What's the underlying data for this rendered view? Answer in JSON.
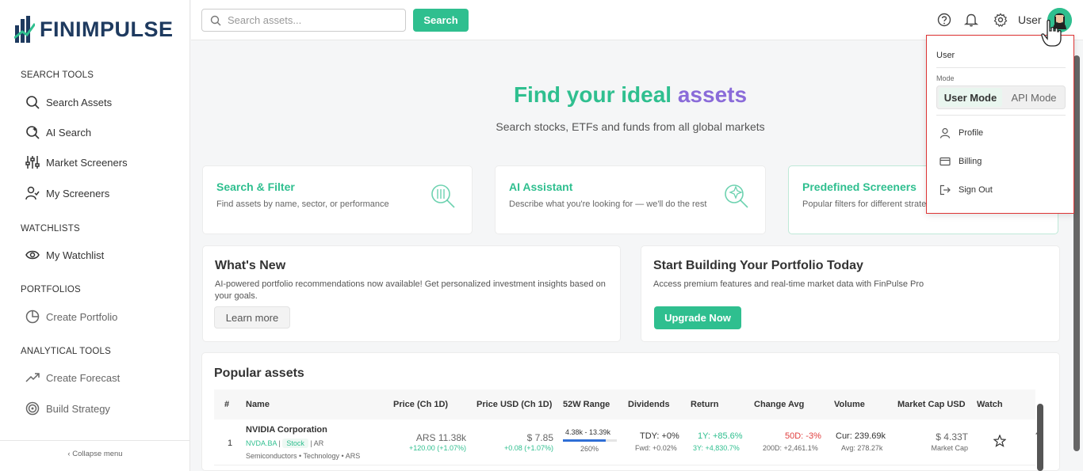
{
  "brand": {
    "name": "FINIMPULSE"
  },
  "sidebar": {
    "sections": [
      {
        "title": "SEARCH TOOLS",
        "items": [
          "Search Assets",
          "AI Search",
          "Market Screeners",
          "My Screeners"
        ]
      },
      {
        "title": "WATCHLISTS",
        "items": [
          "My Watchlist"
        ]
      },
      {
        "title": "PORTFOLIOS",
        "items": [
          "Create Portfolio"
        ]
      },
      {
        "title": "ANALYTICAL TOOLS",
        "items": [
          "Create Forecast",
          "Build Strategy"
        ]
      }
    ],
    "collapse_label": "Collapse menu"
  },
  "topbar": {
    "search_placeholder": "Search assets...",
    "search_button": "Search",
    "user_label": "User"
  },
  "hero": {
    "title_part1": "Find your ideal",
    "title_part2": "assets",
    "subtitle": "Search stocks, ETFs and funds from all global markets"
  },
  "feature_cards": [
    {
      "title": "Search & Filter",
      "desc": "Find assets by name, sector, or performance"
    },
    {
      "title": "AI Assistant",
      "desc": "Describe what you're looking for — we'll do the rest"
    },
    {
      "title": "Predefined Screeners",
      "desc": "Popular filters for different strategies"
    }
  ],
  "whats_new": {
    "title": "What's New",
    "desc": "AI-powered portfolio recommendations now available! Get personalized investment insights based on your goals.",
    "button": "Learn more"
  },
  "portfolio_promo": {
    "title": "Start Building Your Portfolio Today",
    "desc": "Access premium features and real-time market data with FinPulse Pro",
    "button": "Upgrade Now"
  },
  "popular": {
    "title": "Popular assets",
    "columns": [
      "#",
      "Name",
      "Price (Ch 1D)",
      "Price USD (Ch 1D)",
      "52W Range",
      "Dividends",
      "Return",
      "Change Avg",
      "Volume",
      "Market Cap USD",
      "Watch"
    ],
    "rows": [
      {
        "index": "1",
        "name": "NVIDIA Corporation",
        "ticker": "NVDA.BA",
        "type": "Stock",
        "country": "AR",
        "sector": "Semiconductors • Technology • ARS",
        "price": "ARS 11.38k",
        "price_change": "+120.00 (+1.07%)",
        "price_usd": "$ 7.85",
        "price_usd_change": "+0.08 (+1.07%)",
        "range": "4.38k - 13.39k",
        "range_pct": "260%",
        "range_fill": 0.8,
        "div_tdy": "TDY: +0%",
        "div_fwd": "Fwd: +0.02%",
        "return_1y": "1Y: +85.6%",
        "return_3y": "3Y: +4,830.7%",
        "change_50d": "50D: -3%",
        "change_200d": "200D: +2,461.1%",
        "volume_cur": "Cur: 239.69k",
        "volume_avg": "Avg: 278.27k",
        "market_cap": "$ 4.33T",
        "market_cap_label": "Market Cap"
      }
    ]
  },
  "dropdown": {
    "user": "User",
    "mode_label": "Mode",
    "modes": [
      "User Mode",
      "API Mode"
    ],
    "active_mode": "User Mode",
    "items": [
      "Profile",
      "Billing",
      "Sign Out"
    ]
  },
  "colors": {
    "accent": "#2fbf8f",
    "purple": "#8a6bd9",
    "danger": "#e03e3e",
    "navy": "#1e3a5f"
  }
}
